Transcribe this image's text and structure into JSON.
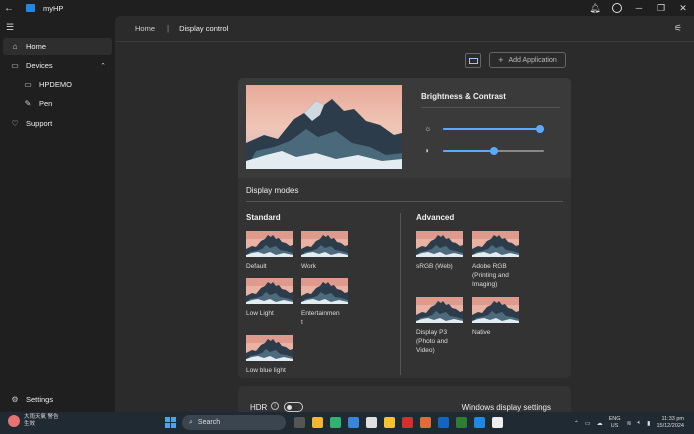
{
  "titlebar": {
    "app_title": "myHP",
    "back_icon": "back-arrow-icon",
    "buttons": [
      "bell-icon",
      "account-icon",
      "minimize-icon",
      "maximize-icon",
      "close-icon"
    ]
  },
  "sidebar": {
    "items": [
      {
        "label": "Home",
        "icon": "home-icon"
      },
      {
        "label": "Devices",
        "icon": "devices-icon"
      },
      {
        "label": "HPDEMO",
        "icon": "laptop-icon"
      },
      {
        "label": "Pen",
        "icon": "pen-icon"
      },
      {
        "label": "Support",
        "icon": "support-icon"
      },
      {
        "label": "Settings",
        "icon": "gear-icon"
      }
    ]
  },
  "breadcrumb": {
    "home": "Home",
    "separator": "|",
    "current": "Display control"
  },
  "toolbar": {
    "add_application": "Add Application"
  },
  "brightness_contrast": {
    "title": "Brightness & Contrast",
    "brightness": 0.96,
    "contrast": 0.5
  },
  "display_modes": {
    "title": "Display modes",
    "standard_title": "Standard",
    "advanced_title": "Advanced",
    "standard": [
      {
        "label": "Default"
      },
      {
        "label": "Work"
      },
      {
        "label": "Low Light"
      },
      {
        "label": "Entertainmen\nt"
      },
      {
        "label": "Low blue light"
      }
    ],
    "advanced": [
      {
        "label": "sRGB (Web)"
      },
      {
        "label": "Adobe RGB\n(Printing and\nImaging)"
      },
      {
        "label": "Display P3\n(Photo and\nVideo)"
      },
      {
        "label": "Native"
      }
    ]
  },
  "hdr": {
    "label": "HDR",
    "enabled": false,
    "windows_link": "Windows display settings"
  },
  "taskbar": {
    "weather_line1": "大雨天氣 警告",
    "weather_line2": "生效",
    "search_placeholder": "Search",
    "lang_line1": "ENG",
    "lang_line2": "US",
    "time": "11:33 pm",
    "date": "15/12/2024"
  }
}
